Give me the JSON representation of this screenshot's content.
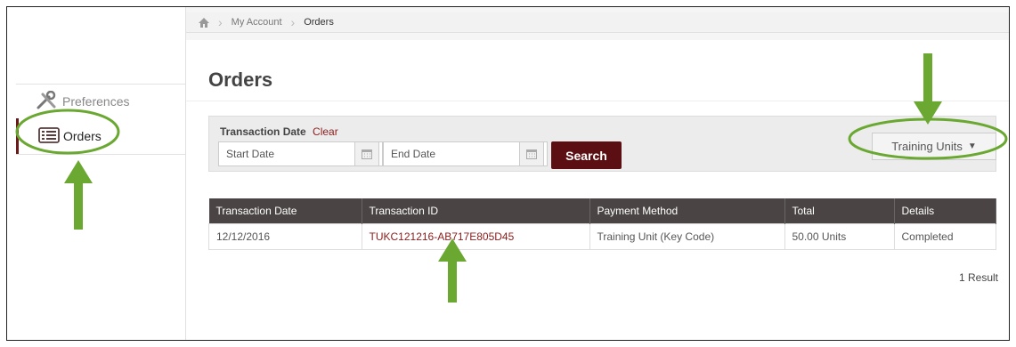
{
  "breadcrumb": {
    "home_icon": "home-icon",
    "items": [
      "My Account",
      "Orders"
    ]
  },
  "sidebar": {
    "items": [
      {
        "label": "Preferences",
        "icon": "tools-icon"
      },
      {
        "label": "Orders",
        "icon": "list-icon",
        "active": true
      }
    ]
  },
  "page": {
    "title": "Orders"
  },
  "filter": {
    "label": "Transaction Date",
    "clear_label": "Clear",
    "start_placeholder": "Start Date",
    "end_placeholder": "End Date",
    "search_label": "Search",
    "units_label": "Training Units"
  },
  "table": {
    "headers": [
      "Transaction Date",
      "Transaction ID",
      "Payment Method",
      "Total",
      "Details"
    ],
    "rows": [
      [
        "12/12/2016",
        "TUKC121216-AB717E805D45",
        "Training Unit (Key Code)",
        "50.00 Units",
        "Completed"
      ]
    ]
  },
  "result_count": "1 Result",
  "colors": {
    "accent": "#5c0f12",
    "header_bg": "#4a4544",
    "link": "#8b1c1c",
    "annotation": "#6aa832"
  }
}
